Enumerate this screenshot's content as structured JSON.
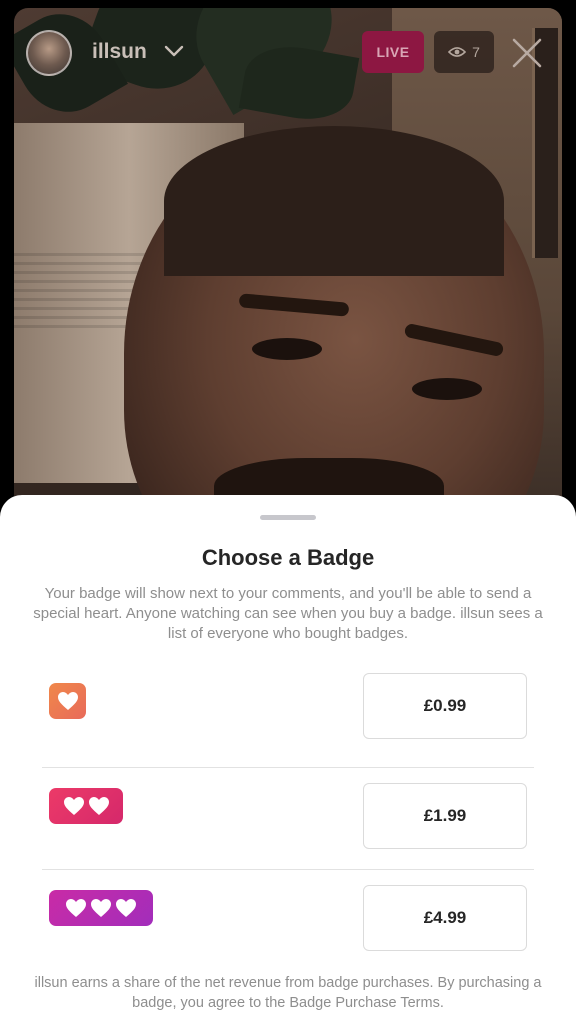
{
  "live": {
    "username": "illsun",
    "live_label": "LIVE",
    "viewer_count": "7",
    "icons": {
      "dropdown": "chevron-down-icon",
      "viewers": "eye-icon",
      "close": "close-icon"
    }
  },
  "sheet": {
    "title": "Choose a Badge",
    "description": "Your badge will show next to your comments, and you'll be able to send a special heart. Anyone watching can see when you buy a badge. illsun sees a list of everyone who bought badges.",
    "badges": [
      {
        "hearts": 1,
        "price": "£0.99",
        "color": "#ee7a50"
      },
      {
        "hearts": 2,
        "price": "£1.99",
        "color": "#e2326a"
      },
      {
        "hearts": 3,
        "price": "£4.99",
        "color": "#b72cb1"
      }
    ],
    "footer": "illsun earns a share of the net revenue from badge purchases. By purchasing a badge, you agree to the Badge Purchase Terms."
  }
}
